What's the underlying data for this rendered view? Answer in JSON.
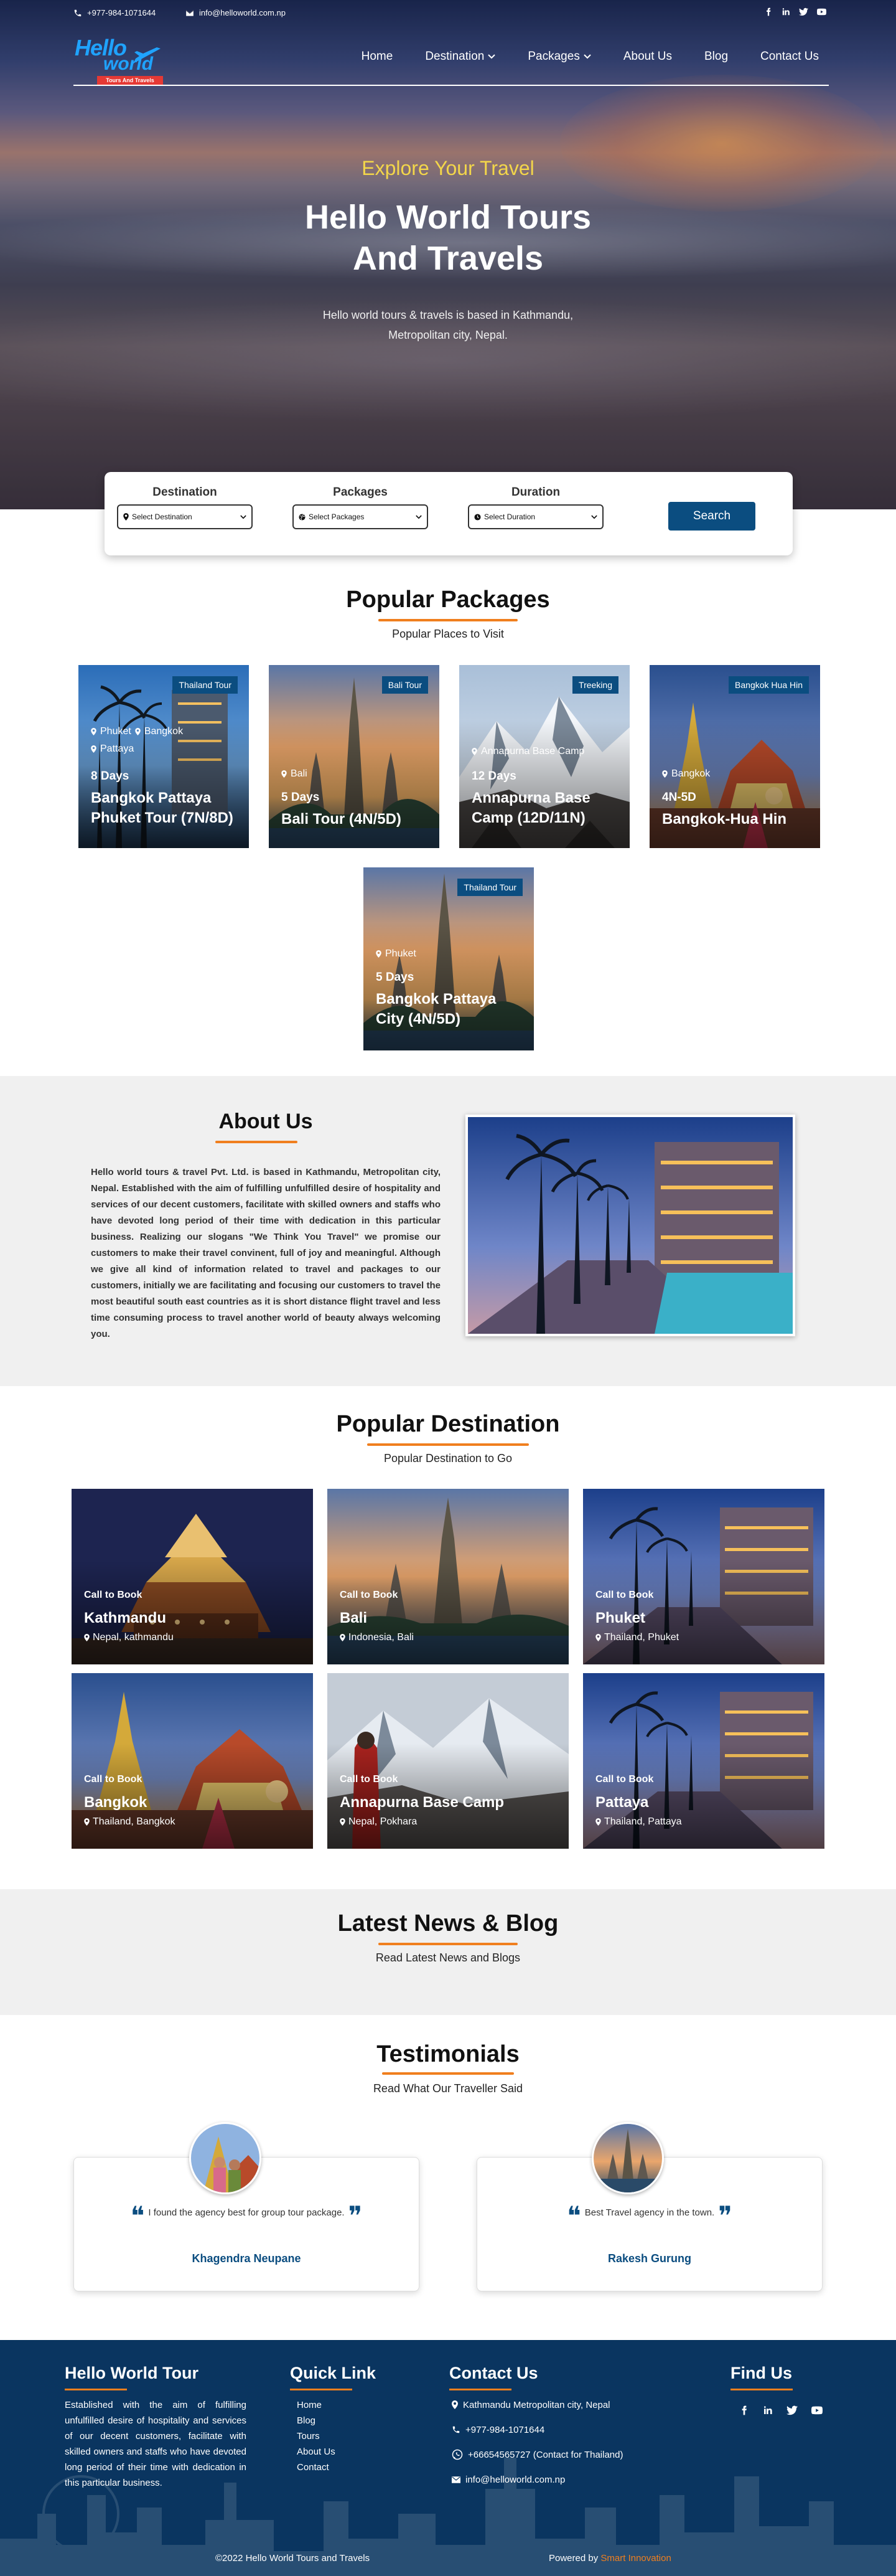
{
  "topbar": {
    "phone": "+977-984-1071644",
    "email": "info@helloworld.com.np"
  },
  "logo": {
    "line1": "Hello",
    "line2": "world",
    "tagline": "Tours And Travels"
  },
  "nav": [
    {
      "label": "Home"
    },
    {
      "label": "Destination"
    },
    {
      "label": "Packages"
    },
    {
      "label": "About Us"
    },
    {
      "label": "Blog"
    },
    {
      "label": "Contact Us"
    }
  ],
  "hero": {
    "eyebrow": "Explore Your Travel",
    "title_line1": "Hello World Tours",
    "title_line2": "And Travels",
    "subtitle_line1": "Hello world tours & travels is based in Kathmandu,",
    "subtitle_line2": "Metropolitan city, Nepal."
  },
  "search": {
    "destination_label": "Destination",
    "destination_value": "Select Destination",
    "packages_label": "Packages",
    "packages_value": "Select Packages",
    "duration_label": "Duration",
    "duration_value": "Select Duration",
    "button": "Search"
  },
  "packages": {
    "title": "Popular Packages",
    "subtitle": "Popular Places to Visit",
    "items": [
      {
        "tag": "Thailand Tour",
        "loc1": "Phuket",
        "loc2": "Bangkok",
        "loc3": "Pattaya",
        "days": "8 Days",
        "name": "Bangkok Pattaya Phuket Tour (7N/8D)"
      },
      {
        "tag": "Bali Tour",
        "loc1": "Bali",
        "days": "5 Days",
        "name": "Bali Tour (4N/5D)"
      },
      {
        "tag": "Treeking",
        "loc1": "Annapurna Base Camp",
        "days": "12 Days",
        "name": "Annapurna Base Camp (12D/11N)"
      },
      {
        "tag": "Bangkok Hua Hin",
        "loc1": "Bangkok",
        "days": "4N-5D",
        "name": "Bangkok-Hua Hin"
      },
      {
        "tag": "Thailand Tour",
        "loc1": "Phuket",
        "days": "5 Days",
        "name": "Bangkok Pattaya City (4N/5D)"
      }
    ]
  },
  "about": {
    "title": "About Us",
    "text": "Hello world tours & travel Pvt. Ltd. is based in Kathmandu, Metropolitan city, Nepal. Established with the aim of fulfilling unfulfilled desire of hospitality and services of our decent customers, facilitate with skilled owners and staffs who have devoted long period of their time with dedication in this particular business. Realizing our slogans \"We Think You Travel\" we promise our customers to make their travel convinent, full of joy and meaningful. Although we give all kind of information related to travel and packages to our customers, initially we are facilitating and focusing our customers to travel the most beautiful south east countries as it is short distance flight travel and less time consuming process to travel another world of beauty always welcoming you."
  },
  "destinations": {
    "title": "Popular Destination",
    "subtitle": "Popular Destination to Go",
    "call": "Call to Book",
    "items": [
      {
        "name": "Kathmandu",
        "loc": "Nepal, kathmandu"
      },
      {
        "name": "Bali",
        "loc": "Indonesia, Bali"
      },
      {
        "name": "Phuket",
        "loc": "Thailand, Phuket"
      },
      {
        "name": "Bangkok",
        "loc": "Thailand, Bangkok"
      },
      {
        "name": "Annapurna Base Camp",
        "loc": "Nepal, Pokhara"
      },
      {
        "name": "Pattaya",
        "loc": "Thailand, Pattaya"
      }
    ]
  },
  "news": {
    "title": "Latest News & Blog",
    "subtitle": "Read Latest News and Blogs"
  },
  "testimonials": {
    "title": "Testimonials",
    "subtitle": "Read What Our Traveller Said",
    "items": [
      {
        "quote": "I found the agency best for group tour package.",
        "name": "Khagendra Neupane"
      },
      {
        "quote": "Best Travel agency in the town.",
        "name": "Rakesh Gurung"
      }
    ]
  },
  "footer": {
    "about_title": "Hello World Tour",
    "about_text": "Established with the aim of fulfilling unfulfilled desire of hospitality and services of our decent customers, facilitate with skilled owners and staffs who have devoted long period of their time with dedication in this particular business.",
    "quick_title": "Quick Link",
    "links": [
      "Home",
      "Blog",
      "Tours",
      "About Us",
      "Contact"
    ],
    "contact_title": "Contact Us",
    "address": "Kathmandu Metropolitan city, Nepal",
    "phone": "+977-984-1071644",
    "whatsapp": "+66654565727 (Contact for Thailand)",
    "email": "info@helloworld.com.np",
    "find_title": "Find Us",
    "copyright": "©2022 Hello World Tours and Travels",
    "powered_prefix": "Powered by ",
    "powered_by": "Smart Innovation"
  },
  "colors": {
    "accent": "#f07f1e",
    "brand": "#0b4d80",
    "footer": "#0a3560",
    "eyebrow": "#f3d64a"
  }
}
